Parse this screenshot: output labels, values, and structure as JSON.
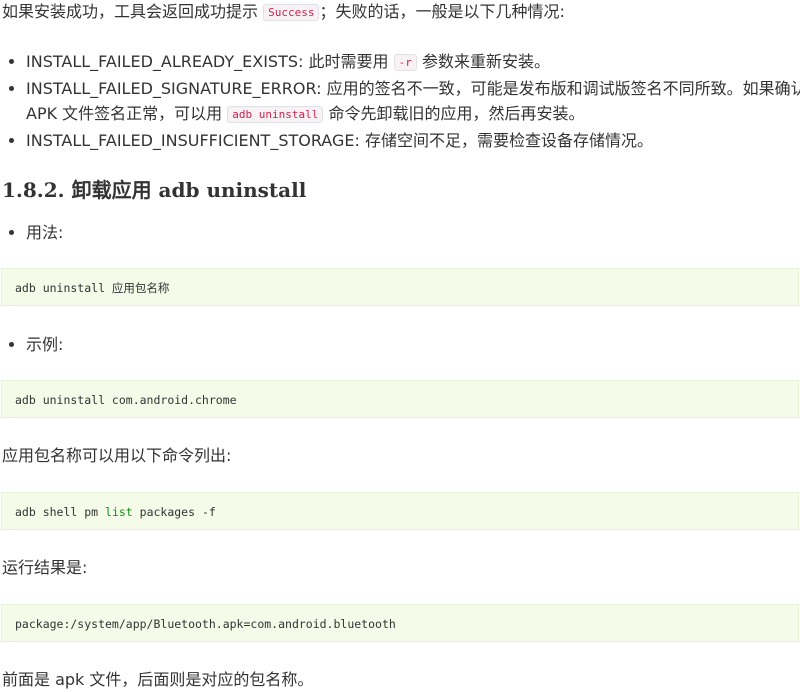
{
  "intro": {
    "before": "如果安装成功，工具会返回成功提示",
    "code": "Success",
    "after": "；失败的话，一般是以下几种情况:"
  },
  "errors": [
    {
      "text_before": "INSTALL_FAILED_ALREADY_EXISTS: 此时需要用",
      "code": "-r",
      "text_after": "参数来重新安装。"
    },
    {
      "text_before": "INSTALL_FAILED_SIGNATURE_ERROR: 应用的签名不一致，可能是发布版和调试版签名不同所致。如果确认 APK 文件签名正常，可以用",
      "code": "adb uninstall",
      "text_after": "命令先卸载旧的应用，然后再安装。"
    },
    {
      "text_before": "INSTALL_FAILED_INSUFFICIENT_STORAGE: 存储空间不足，需要检查设备存储情况。",
      "code": "",
      "text_after": ""
    }
  ],
  "section": {
    "heading": "1.8.2. 卸载应用 adb uninstall"
  },
  "usage": {
    "label": "用法:",
    "code": "adb uninstall 应用包名称"
  },
  "example": {
    "label": "示例:",
    "code": "adb uninstall com.android.chrome"
  },
  "list_packages": {
    "text": "应用包名称可以用以下命令列出:",
    "code_before": "adb shell pm ",
    "code_keyword": "list",
    "code_after": " packages -f"
  },
  "result": {
    "text": "运行结果是:",
    "code": "package:/system/app/Bluetooth.apk=com.android.bluetooth"
  },
  "footer": {
    "text": "前面是 apk 文件，后面则是对应的包名称。"
  }
}
